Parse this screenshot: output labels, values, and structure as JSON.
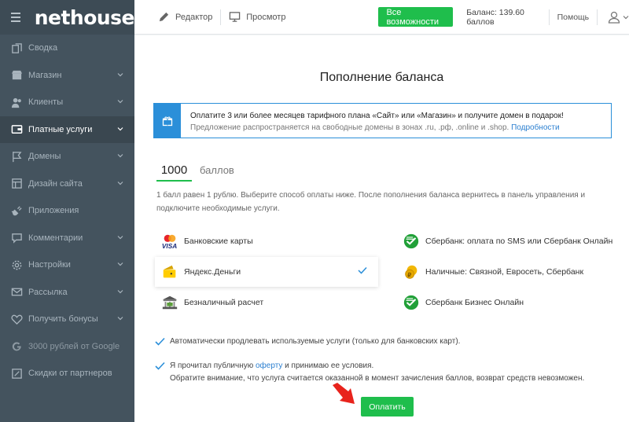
{
  "app": {
    "logo": "nethouse"
  },
  "sidebar": {
    "items": [
      {
        "label": "Сводка",
        "icon": "copy-icon",
        "chevron": false
      },
      {
        "label": "Магазин",
        "icon": "store-icon",
        "chevron": true
      },
      {
        "label": "Клиенты",
        "icon": "users-icon",
        "chevron": true
      },
      {
        "label": "Платные услуги",
        "icon": "wallet-icon",
        "chevron": true,
        "active": true
      },
      {
        "label": "Домены",
        "icon": "flag-icon",
        "chevron": true
      },
      {
        "label": "Дизайн сайта",
        "icon": "layout-icon",
        "chevron": true
      },
      {
        "label": "Приложения",
        "icon": "plug-icon",
        "chevron": false
      },
      {
        "label": "Комментарии",
        "icon": "comment-icon",
        "chevron": true
      },
      {
        "label": "Настройки",
        "icon": "gear-icon",
        "chevron": true
      },
      {
        "label": "Рассылка",
        "icon": "mail-icon",
        "chevron": true
      },
      {
        "label": "Получить бонусы",
        "icon": "heart-icon",
        "chevron": true
      },
      {
        "label": "3000 рублей от Google",
        "icon": "google-icon",
        "chevron": false,
        "dim": true
      },
      {
        "label": "Скидки от партнеров",
        "icon": "discount-icon",
        "chevron": false
      }
    ]
  },
  "topbar": {
    "editor": "Редактор",
    "view": "Просмотр",
    "features": "Все возможности",
    "balance": "Баланс: 139.60 баллов",
    "help": "Помощь"
  },
  "page": {
    "title": "Пополнение баланса",
    "promo": {
      "line1": "Оплатите 3 или более месяцев тарифного плана «Сайт» или «Магазин» и получите домен в подарок!",
      "line2": "Предложение распространяется на свободные домены в зонах .ru, .рф, .online и .shop.",
      "link": "Подробности"
    },
    "amount": {
      "value": "1000",
      "unit": "баллов"
    },
    "hint": "1 балл равен 1 рублю. Выберите способ оплаты ниже. После пополнения баланса вернитесь в панель управления и подключите необходимые услуги.",
    "methods": [
      {
        "label": "Банковские карты",
        "icon": "visa-mastercard-icon"
      },
      {
        "label": "Сбербанк: оплата по SMS или Сбербанк Онлайн",
        "icon": "sberbank-icon"
      },
      {
        "label": "Яндекс.Деньги",
        "icon": "yandex-money-icon",
        "selected": true
      },
      {
        "label": "Наличные: Связной, Евросеть, Сбербанк",
        "icon": "cash-coin-icon"
      },
      {
        "label": "Безналичный расчет",
        "icon": "bank-icon"
      },
      {
        "label": "Сбербанк Бизнес Онлайн",
        "icon": "sberbank-icon"
      }
    ],
    "autorenew": "Автоматически продлевать используемые услуги (только для банковских карт).",
    "offer_pre": "Я прочитал публичную ",
    "offer_link": "оферту",
    "offer_post": " и принимаю ее условия.",
    "offer_note": "Обратите внимание, что услуга считается оказанной в момент зачисления баллов, возврат средств невозможен.",
    "pay_button": "Оплатить"
  },
  "colors": {
    "accent": "#1fbe4c",
    "sidebar": "#44535e",
    "link": "#2b7fd0",
    "promo": "#2b8fd9"
  }
}
